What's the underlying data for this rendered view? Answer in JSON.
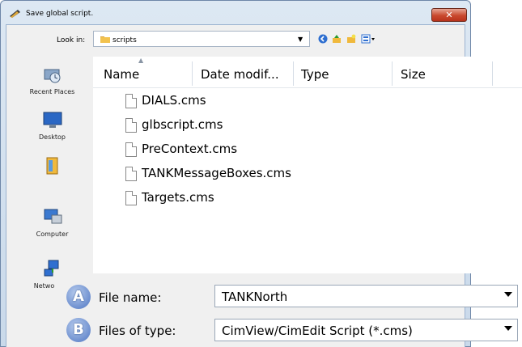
{
  "window": {
    "title": "Save global script.",
    "close_glyph": "✕"
  },
  "lookin": {
    "label": "Look in:",
    "value": "scripts",
    "arrow": "▼"
  },
  "toolbar": {
    "icons": [
      "back-icon",
      "up-folder-icon",
      "new-folder-icon",
      "view-menu-icon"
    ]
  },
  "places": [
    {
      "label": "Recent Places",
      "icon": "recent-places-icon"
    },
    {
      "label": "Desktop",
      "icon": "desktop-icon"
    },
    {
      "label": "",
      "icon": "user-folder-icon"
    },
    {
      "label": "Computer",
      "icon": "computer-icon"
    },
    {
      "label": "Netwo",
      "icon": "network-icon"
    }
  ],
  "columns": {
    "name": "Name",
    "date": "Date modif...",
    "type": "Type",
    "size": "Size"
  },
  "files": [
    "DIALS.cms",
    "glbscript.cms",
    "PreContext.cms",
    "TANKMessageBoxes.cms",
    "Targets.cms"
  ],
  "file_name": {
    "label": "File name:",
    "value": "TANKNorth",
    "badge": "A"
  },
  "file_type": {
    "label": "Files of type:",
    "value": "CimView/CimEdit Script (*.cms)",
    "badge": "B"
  },
  "colors": {
    "accent": "#5d81c4",
    "close": "#c9492e",
    "frame": "#c9d9ea"
  }
}
